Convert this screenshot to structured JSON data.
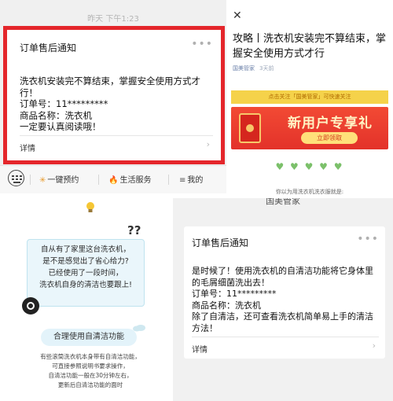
{
  "panel1": {
    "timestamp": "昨天 下午1:23",
    "card": {
      "title": "订单售后通知",
      "more": "•••",
      "lines": [
        "洗衣机安装完不算结束，掌握安全使用方式才",
        "行！",
        "订单号：11*********",
        "商品名称：洗衣机",
        "一定要认真阅读哦！"
      ],
      "detail_label": "详情",
      "chevron": "›"
    },
    "menu": [
      {
        "icon": "✳",
        "label": "一键预约"
      },
      {
        "icon": "🔥",
        "label": "生活服务"
      },
      {
        "icon": "≡",
        "label": "我的"
      }
    ]
  },
  "panel2": {
    "close": "✕",
    "headline": "攻略丨洗衣机安装完不算结束，掌握安全使用方式才行",
    "meta": [
      "国美管家",
      "3天前"
    ],
    "ad_strip": "点击关注「国美管家」可快速关注",
    "banner": {
      "title": "新用户专享礼",
      "button": "立即领取"
    },
    "hearts": "♥ ♥ ♥ ♥ ♥",
    "caption": "你以为用洗衣机洗衣服就是:"
  },
  "panel3": {
    "qmarks": "??",
    "bubble_lines": [
      "自从有了家里这台洗衣机，",
      "是不是感觉出了省心给力?",
      "已经使用了一段时间，",
      "洗衣机自身的清洁也要跟上!"
    ],
    "pill": "合理使用自清洁功能",
    "desc_lines": [
      "有些滚筒洗衣机本身带有自清洁功能，",
      "可直接参照说明书要求操作，",
      "自清洁功能一般在30分钟左右，",
      "更新后自清洁功能的面时"
    ]
  },
  "panel4": {
    "topbar_title": "国美管家",
    "card": {
      "title": "订单售后通知",
      "more": "•••",
      "lines": [
        "是时候了！使用洗衣机的自清洁功能将它身体里",
        "的毛屑细菌洗出去！",
        "订单号：11*********",
        "商品名称：洗衣机",
        "除了自清洁，还可查看洗衣机简单易上手的清洁",
        "方法！"
      ],
      "detail_label": "详情",
      "chevron": "›"
    }
  },
  "colors": {
    "highlight_border": "#e4262b",
    "banner_red": "#e3322a",
    "ad_yellow": "#f5d24a",
    "heart_green": "#7bc06a"
  }
}
